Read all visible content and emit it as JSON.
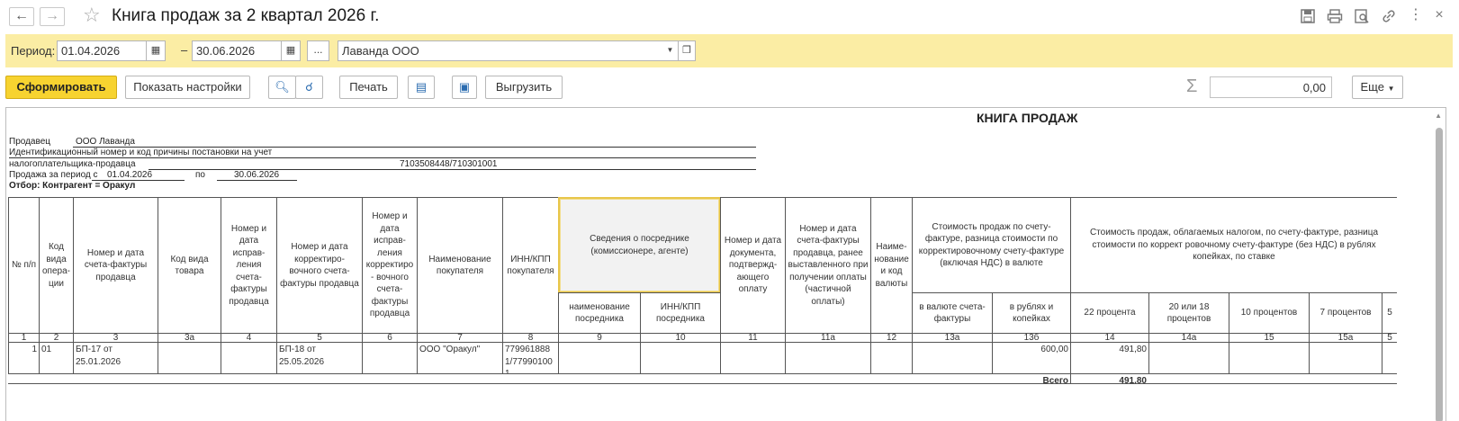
{
  "window": {
    "title": "Книга продаж за 2 квартал 2026 г.",
    "back_icon": "arrow-left-icon",
    "forward_icon": "arrow-right-icon",
    "favorite_icon": "star-icon",
    "toolbar_icons": [
      "save-icon",
      "print-icon",
      "preview-icon",
      "link-icon",
      "more-vertical-icon",
      "close-icon"
    ]
  },
  "period": {
    "label": "Период:",
    "from": "01.04.2026",
    "to": "30.06.2026",
    "dash": "–",
    "ellipsis": "...",
    "organization": "Лаванда ООО"
  },
  "toolbar": {
    "generate": "Сформировать",
    "show_settings": "Показать настройки",
    "print": "Печать",
    "export": "Выгрузить",
    "more": "Еще",
    "sum_value": "0,00"
  },
  "report": {
    "title": "КНИГА ПРОДАЖ",
    "seller_label": "Продавец",
    "seller_value": "ООО Лаванда",
    "inn_label_1": "Идентификационный номер и код причины постановки на учет",
    "inn_label_2": "налогоплательщика-продавца",
    "inn_value": "7103508448/710301001",
    "period_from_label": "Продажа за период с",
    "period_from": "01.04.2026",
    "period_to_label": "по",
    "period_to": "30.06.2026",
    "filter": "Отбор: Контрагент = Оракул",
    "headers": {
      "c1": "№ п/п",
      "c2": "Код вида опера-ции",
      "c3": "Номер и дата счета-фактуры продавца",
      "c3a": "Код вида товара",
      "c4": "Номер и дата исправ-ления счета-фактуры продавца",
      "c5": "Номер и дата корректиро-вочного счета-фактуры продавца",
      "c6": "Номер и дата исправ-ления корректиро - вочного счета-фактуры продавца",
      "c7": "Наименование покупателя",
      "c8": "ИНН/КПП покупателя",
      "agent": "Сведения о посреднике (комиссионере, агенте)",
      "c9": "наименование посредника",
      "c10": "ИНН/КПП посредника",
      "c11": "Номер и дата документа, подтвержд-ающего оплату",
      "c11a": "Номер и дата счета-фактуры продавца, ранее выставленного при получении оплаты (частичной оплаты)",
      "c12": "Наиме-нование и код валюты",
      "cost": "Стоимость продаж по счету-фактуре, разница стоимости по корректировочному счету-фактуре (включая НДС) в валюте",
      "c13a": "в валюте счета-фактуры",
      "c13b": "в рублях и копейках",
      "taxed": "Стоимость продаж, облагаемых налогом, по счету-фактуре, разница стоимости по коррект ровочному счету-фактуре (без НДС) в рублях копейках, по ставке",
      "c14": "22 процента",
      "c14a": "20 или 18 процентов",
      "c15": "10 процентов",
      "c15a": "7 процентов",
      "c16": "5"
    },
    "numbers": [
      "1",
      "2",
      "3",
      "3а",
      "4",
      "5",
      "6",
      "7",
      "8",
      "9",
      "10",
      "11",
      "11а",
      "12",
      "13а",
      "13б",
      "14",
      "14а",
      "15",
      "15а",
      "5"
    ],
    "row": {
      "n": "1",
      "op": "01",
      "invoice": "БП-17 от 25.01.2026",
      "corr": "БП-18 от 25.05.2026",
      "buyer": "ООО \"Оракул\"",
      "inn": "7799618881/77990100 1",
      "total_rub": "600,00",
      "vat22": "491,80"
    },
    "total_label": "Всего",
    "total_value": "491,80"
  }
}
